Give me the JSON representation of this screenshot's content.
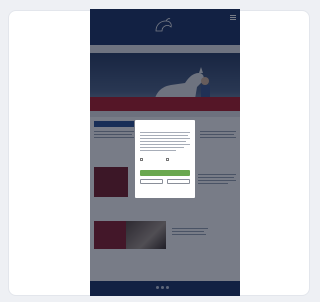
{
  "header": {
    "logo_text": "",
    "menu_icon": "hamburger-icon"
  },
  "nav": {
    "items": [
      "",
      "",
      "",
      "",
      "",
      "",
      ""
    ]
  },
  "hero": {
    "title": ""
  },
  "content": {
    "section_tab": "",
    "section1_title": "",
    "section2_title": "",
    "section3_title": ""
  },
  "sponsors": [
    "",
    "",
    "",
    "",
    ""
  ],
  "footer": {
    "left_text": "",
    "center_text": "",
    "right_text": ""
  },
  "cookie_modal": {
    "title": "",
    "option1_label": "",
    "option2_label": "",
    "accept_label": "",
    "save_label": "",
    "deny_label": "",
    "links": ""
  },
  "colors": {
    "navy": "#1d3768",
    "red": "#b21d2c",
    "accept_green": "#6aa84f",
    "tab_blue": "#2a5394"
  }
}
